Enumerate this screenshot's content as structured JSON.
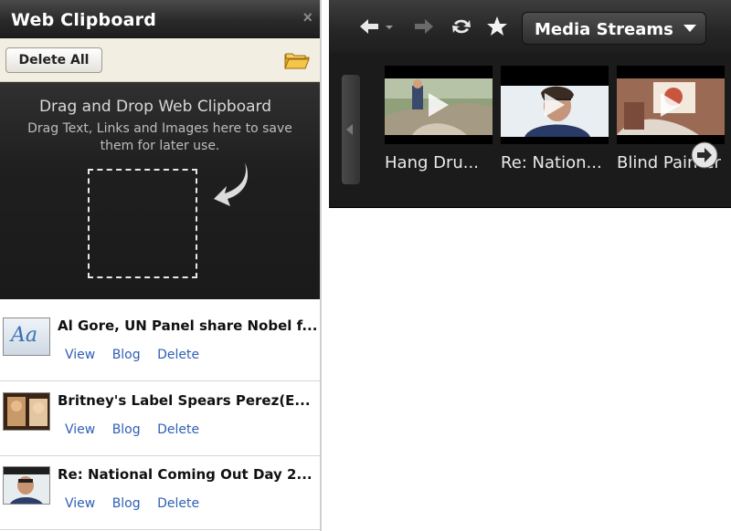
{
  "clipboard": {
    "title": "Web Clipboard",
    "close_label": "×",
    "delete_all_label": "Delete All",
    "drop_heading": "Drag and Drop Web Clipboard",
    "drop_subtext": "Drag Text, Links and Images here to save them for later use.",
    "items": [
      {
        "title": "Al Gore, UN Panel share Nobel f...",
        "thumb_text": "Aa",
        "view": "View",
        "blog": "Blog",
        "delete": "Delete"
      },
      {
        "title": "Britney's Label Spears Perez(E...",
        "view": "View",
        "blog": "Blog",
        "delete": "Delete"
      },
      {
        "title": "Re: National Coming Out Day 2...",
        "view": "View",
        "blog": "Blog",
        "delete": "Delete"
      }
    ]
  },
  "media": {
    "dropdown_label": "Media Streams",
    "icons": [
      "back-arrow-icon",
      "forward-arrow-icon",
      "refresh-icon",
      "star-icon",
      "chevron-down-icon",
      "play-icon",
      "next-arrow-icon"
    ],
    "items": [
      {
        "caption": "Hang Dru..."
      },
      {
        "caption": "Re: Nation..."
      },
      {
        "caption": "Blind Painter"
      }
    ]
  },
  "colors": {
    "link": "#2f5fb3",
    "dark_panel": "#1b1b1b",
    "toolbar_cream": "#f2efe2"
  }
}
